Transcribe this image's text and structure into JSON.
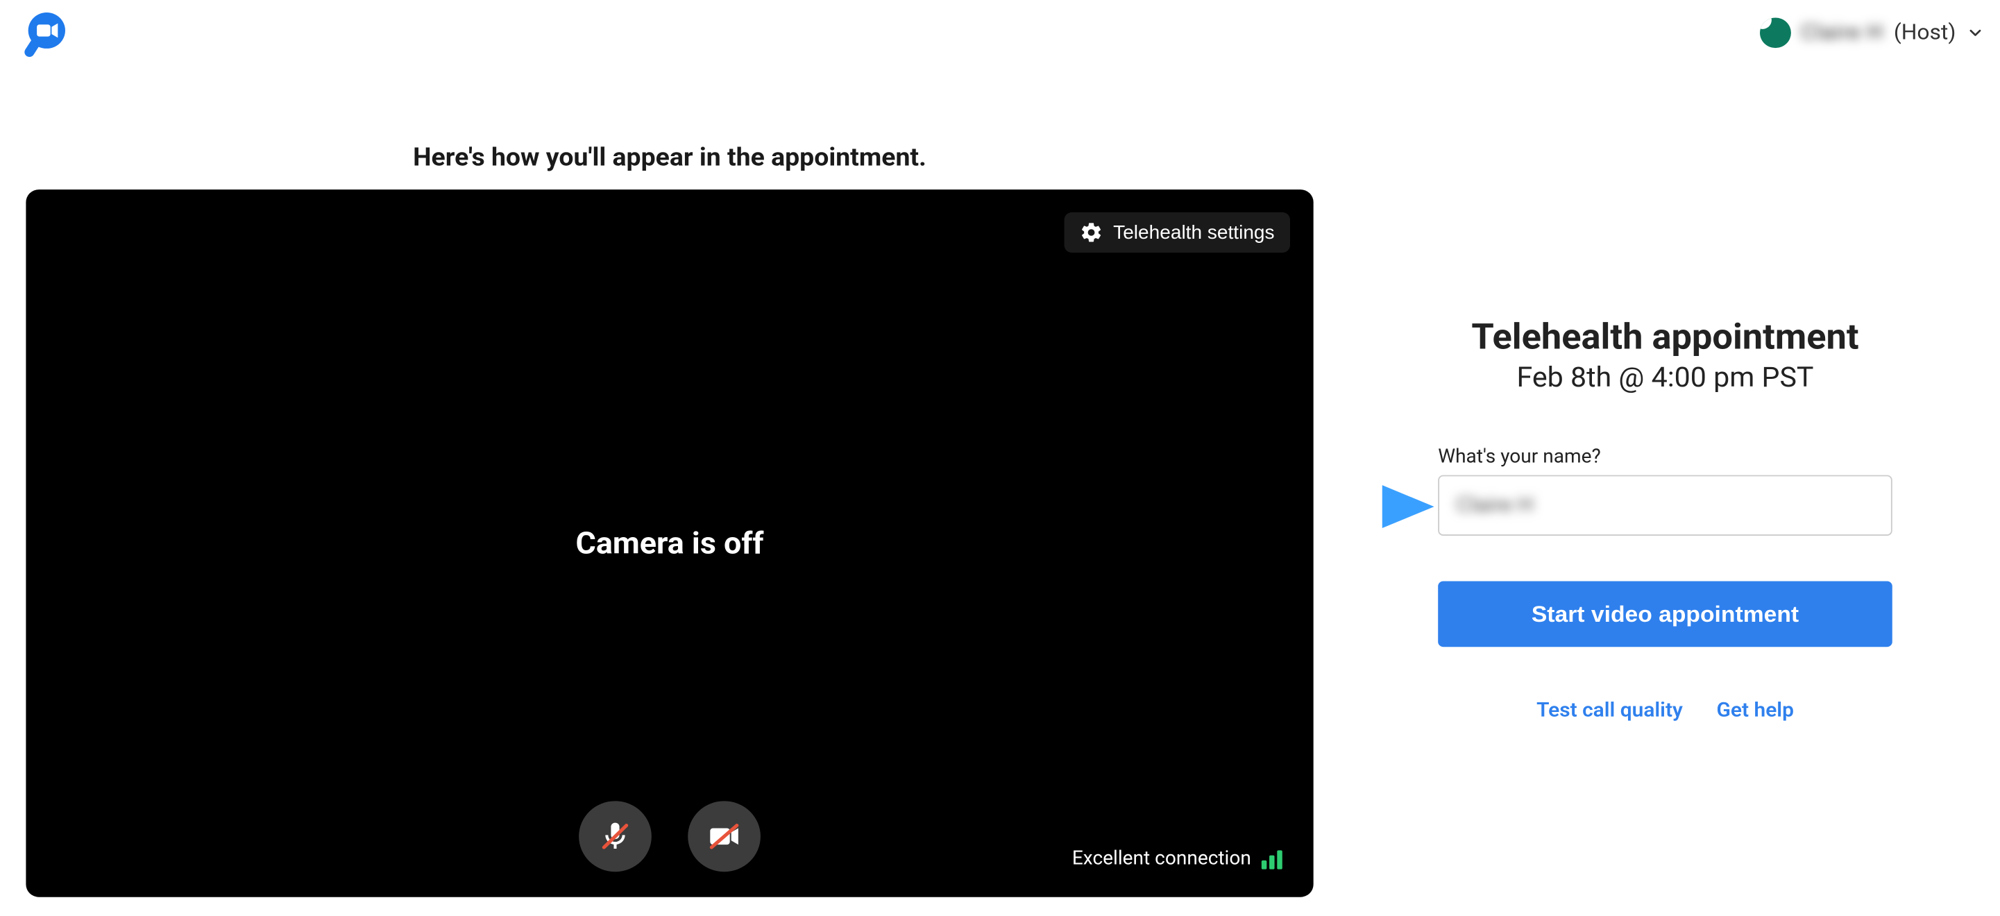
{
  "header": {
    "user_name": "Claire H",
    "user_role": "(Host)"
  },
  "preview": {
    "heading": "Here's how you'll appear in the appointment.",
    "settings_label": "Telehealth settings",
    "camera_off_text": "Camera is off",
    "connection_text": "Excellent connection"
  },
  "appointment": {
    "title": "Telehealth appointment",
    "datetime": "Feb 8th @ 4:00 pm PST",
    "name_label": "What's your name?",
    "name_value": "Claire H",
    "start_button": "Start video appointment",
    "test_call_link": "Test call quality",
    "get_help_link": "Get help"
  }
}
